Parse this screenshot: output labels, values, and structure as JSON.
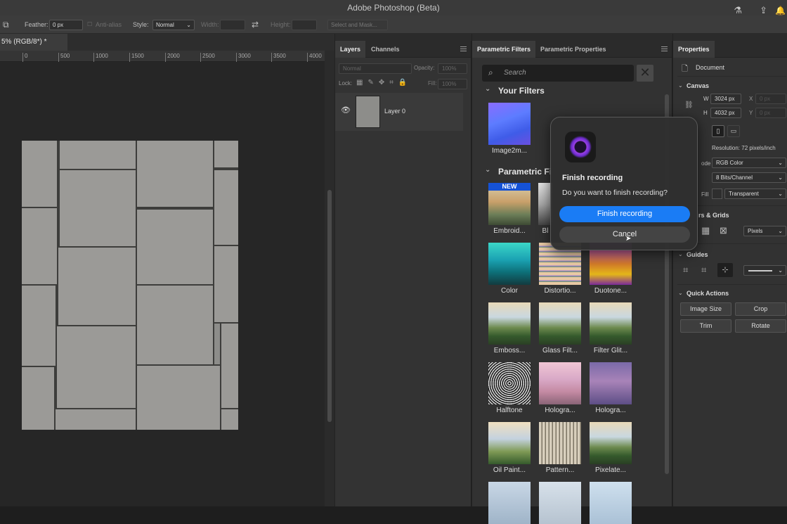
{
  "app": {
    "title": "Adobe Photoshop (Beta)"
  },
  "options_bar": {
    "feather_label": "Feather:",
    "feather_value": "0 px",
    "anti_alias_label": "Anti-alias",
    "style_label": "Style:",
    "style_value": "Normal",
    "width_label": "Width:",
    "height_label": "Height:",
    "select_mask_label": "Select and Mask..."
  },
  "document": {
    "tab_title": "5% (RGB/8*) *",
    "ruler_ticks": [
      "0",
      "500",
      "1000",
      "1500",
      "2000",
      "2500",
      "3000",
      "3500",
      "4000"
    ]
  },
  "layers_panel": {
    "tabs": [
      "Layers",
      "Channels"
    ],
    "blend_mode": "Normal",
    "opacity_label": "Opacity:",
    "opacity_value": "100%",
    "lock_label": "Lock:",
    "fill_label": "Fill:",
    "fill_value": "100%",
    "layers": [
      {
        "name": "Layer 0"
      }
    ]
  },
  "filters_panel": {
    "tabs": [
      "Parametric Filters",
      "Parametric Properties"
    ],
    "search_placeholder": "Search",
    "your_filters_title": "Your Filters",
    "your_filters": [
      {
        "label": "Image2m..."
      }
    ],
    "parametric_title": "Parametric Fi",
    "new_badge": "NEW",
    "filters": [
      {
        "label": "Embroid..."
      },
      {
        "label": "Bl"
      },
      {
        "label": "Color"
      },
      {
        "label": "Distortio..."
      },
      {
        "label": "Duotone..."
      },
      {
        "label": "Emboss..."
      },
      {
        "label": "Glass Filt..."
      },
      {
        "label": "Filter Glit..."
      },
      {
        "label": "Halftone"
      },
      {
        "label": "Hologra..."
      },
      {
        "label": "Hologra..."
      },
      {
        "label": "Oil Paint..."
      },
      {
        "label": "Pattern..."
      },
      {
        "label": "Pixelate..."
      }
    ]
  },
  "properties_panel": {
    "tab": "Properties",
    "document_label": "Document",
    "canvas_title": "Canvas",
    "w_label": "W",
    "w_value": "3024 px",
    "h_label": "H",
    "h_value": "4032 px",
    "x_label": "X",
    "x_value": "0 px",
    "y_label": "Y",
    "y_value": "0 px",
    "resolution": "Resolution: 72 pixels/inch",
    "mode_label": "ode",
    "mode_value": "RGB Color",
    "depth_value": "8 Bits/Channel",
    "fill_label": "Fill",
    "fill_value": "Transparent",
    "rulers_title": "rs & Grids",
    "units_value": "Pixels",
    "guides_title": "Guides",
    "quick_actions_title": "Quick Actions",
    "buttons": {
      "image_size": "Image Size",
      "crop": "Crop",
      "trim": "Trim",
      "rotate": "Rotate"
    }
  },
  "dialog": {
    "title": "Finish recording",
    "message": "Do you want to finish recording?",
    "confirm_label": "Finish recording",
    "cancel_label": "Cancel"
  },
  "colors": {
    "accent": "#1a7cf5",
    "panel_bg": "#333333",
    "app_bg": "#1e1e1e"
  }
}
